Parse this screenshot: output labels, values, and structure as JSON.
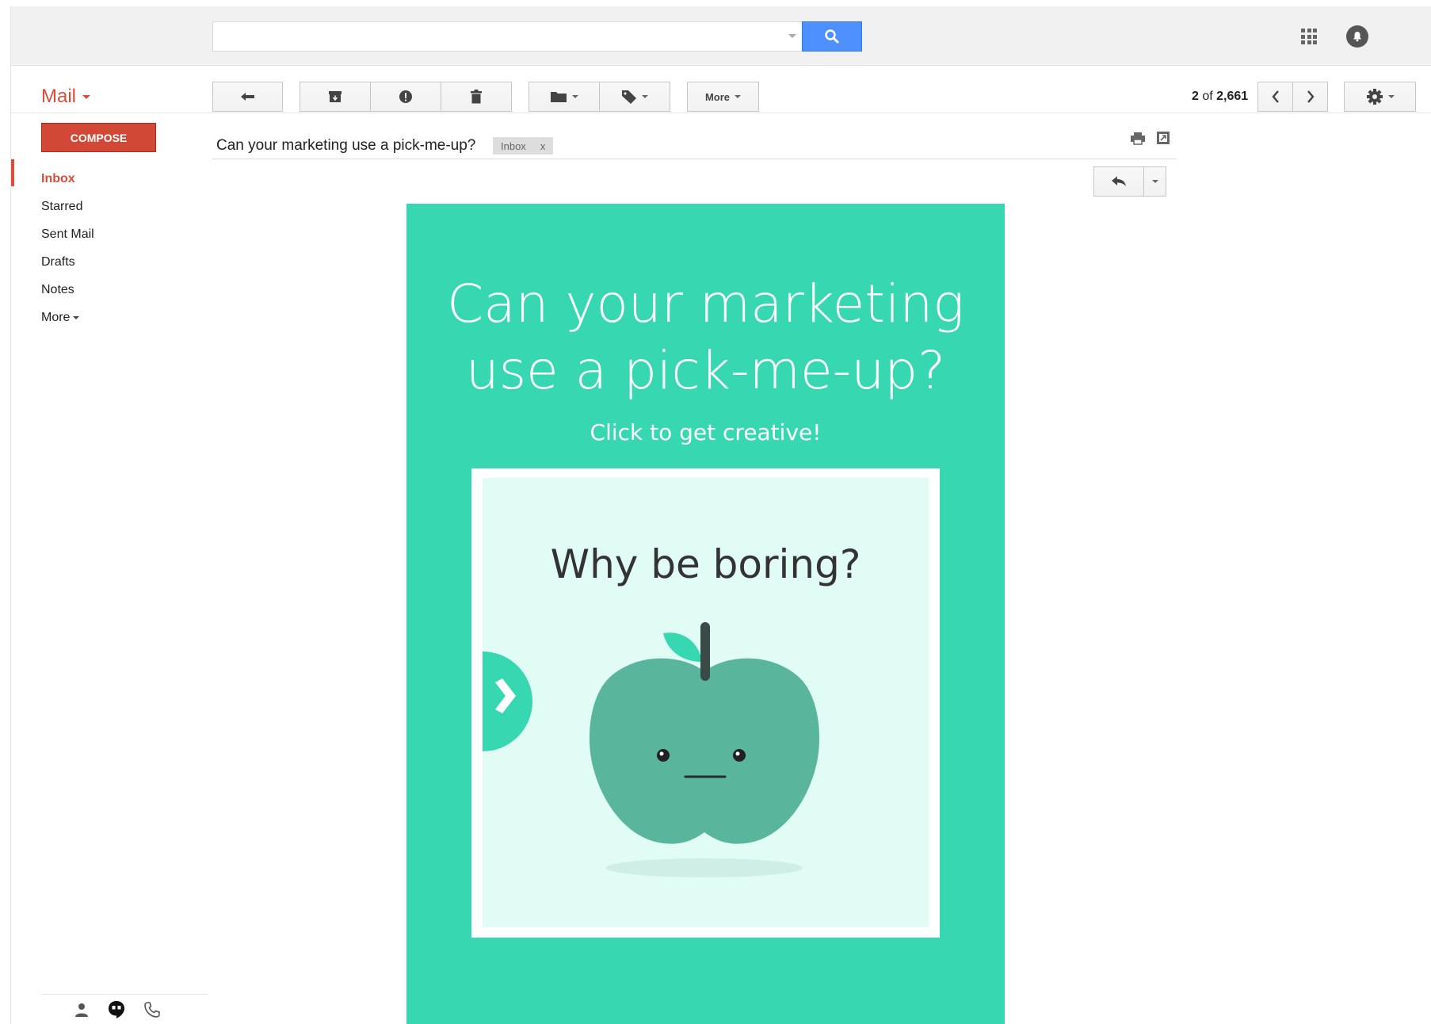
{
  "header": {
    "search": {
      "value": "",
      "placeholder": ""
    }
  },
  "toolbar": {
    "mail_label": "Mail",
    "more_label": "More",
    "pager": {
      "current": "2",
      "of": "of",
      "total": "2,661"
    }
  },
  "sidebar": {
    "compose_label": "COMPOSE",
    "items": [
      {
        "label": "Inbox",
        "active": true
      },
      {
        "label": "Starred"
      },
      {
        "label": "Sent Mail"
      },
      {
        "label": "Drafts"
      },
      {
        "label": "Notes"
      },
      {
        "label": "More"
      }
    ]
  },
  "message": {
    "subject": "Can your marketing use a pick-me-up?",
    "tag": {
      "label": "Inbox",
      "remove": "x"
    }
  },
  "email": {
    "heading_line1": "Can your marketing",
    "heading_line2": "use a pick-me-up?",
    "subheading": "Click to get creative!",
    "card_title": "Why be boring?"
  },
  "colors": {
    "brand_red": "#dd4b39",
    "compose_red": "#d14836",
    "search_blue": "#4d90fe",
    "email_teal": "#37d8b1",
    "card_bg": "#e1fbf5",
    "apple_green": "#5ab59d"
  },
  "icons": [
    "search-icon",
    "apps-grid-icon",
    "notifications-icon",
    "back-arrow-icon",
    "archive-icon",
    "report-spam-icon",
    "delete-icon",
    "folder-icon",
    "label-icon",
    "chevron-left-icon",
    "chevron-right-icon",
    "settings-gear-icon",
    "print-icon",
    "new-window-icon",
    "reply-icon",
    "person-icon",
    "hangouts-icon",
    "phone-icon",
    "chevron-right-arrow-icon",
    "apple-illustration"
  ]
}
